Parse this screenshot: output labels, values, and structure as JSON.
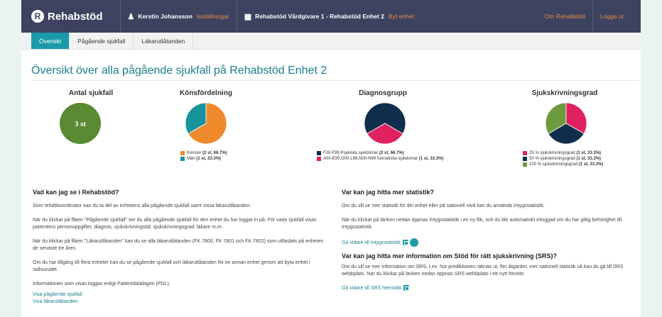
{
  "header": {
    "logo_text": "Rehabstöd",
    "logo_mark": "R",
    "user_name": "Kerstin Johansson",
    "settings_link": "Inställningar",
    "unit_name": "Rehabstöd Vårdgivare 1 - Rehabstöd Enhet 2",
    "change_unit_link": "Byt enhet",
    "about_link": "Om Rehabstöd",
    "logout_link": "Logga ut"
  },
  "tabs": [
    {
      "label": "Översikt",
      "active": true
    },
    {
      "label": "Pågående sjukfall",
      "active": false
    },
    {
      "label": "Läkarutlåtanden",
      "active": false
    }
  ],
  "page_title": "Översikt över alla pågående sjukfall på Rehabstöd Enhet 2",
  "stats": {
    "count": {
      "title": "Antal sjukfall",
      "value": "3 st",
      "color": "#5a8a34"
    },
    "gender": {
      "title": "Könsfördelning",
      "slices": [
        {
          "label": "Kvinnor",
          "detail": "(2 st, 66.7%)",
          "fraction": 0.667,
          "color": "#ef8a2c"
        },
        {
          "label": "Män",
          "detail": "(1 st, 33.3%)",
          "fraction": 0.333,
          "color": "#17939d"
        }
      ]
    },
    "diagnosis": {
      "title": "Diagnosgrupp",
      "slices": [
        {
          "label": "F00-F99 Psykiska sjukdomar",
          "detail": "(2 st, 66.7%)",
          "fraction": 0.667,
          "color": "#0f2d4d"
        },
        {
          "label": "A00-E90,G00-L99,N00-N99 Somatiska sjukdomar",
          "detail": "(1 st, 33.3%)",
          "fraction": 0.333,
          "color": "#e0215f"
        }
      ]
    },
    "degree": {
      "title": "Sjukskrivningsgrad",
      "slices": [
        {
          "label": "25 % sjukskrivningsgrad",
          "detail": "(1 st, 33.3%)",
          "fraction": 0.333,
          "color": "#e0215f"
        },
        {
          "label": "50 % sjukskrivningsgrad",
          "detail": "(1 st, 33.3%)",
          "fraction": 0.333,
          "color": "#0f2d4d"
        },
        {
          "label": "100 % sjukskrivningsgrad",
          "detail": "(1 st, 33.3%)",
          "fraction": 0.334,
          "color": "#6e9a3e"
        }
      ]
    }
  },
  "left_info": {
    "heading": "Vad kan jag se i Rehabstöd?",
    "paragraphs": [
      "Som rehabkoordinator kan du ta del av enhetens alla pågående sjukfall samt vissa läkarutlåtanden.",
      "När du klickar på fliken \"Pågående sjukfall\" ser du alla pågående sjukfall för den enhet du har loggat in på. För varje sjukfall visas patientens personuppgifter, diagnos, sjukskrivningstid, sjukskrivningsgrad, läkare m.m.",
      "När du klickar på fliken \"Läkarutlåtanden\" kan du se alla läkarutlåtanden (FK 7800, FK 7801 och FK 7802) som utfärdats på enheten de senaste tre åren.",
      "Om du har tillgång till flera enheter kan du se pågående sjukfall och läkarutlåtanden för en annan enhet genom att byta enhet i sidhuvudet.",
      "Informationen som visas loggas enligt Patientdatalagen (PDL)."
    ],
    "link_sjukfall": "Visa pågående sjukfall",
    "link_lakarutlatanden": "Visa läkarutlåtanden"
  },
  "right_info": {
    "stats_heading": "Var kan jag hitta mer statistik?",
    "stats_p1": "Om du vill se mer statistik för din enhet eller på nationell nivå kan du använda Intygsstatistik.",
    "stats_p2": "När du klickar på länken nedan öppnas Intygsstatistik i en ny flik, och du blir automatiskt inloggad om du har giltig behörighet till Intygsstatistik.",
    "stats_link": "Gå vidare till Intygsstatistik",
    "srs_heading": "Var kan jag hitta mer information om Stöd för rätt sjukskrivning (SRS)?",
    "srs_p1": "Om du vill se mer information om SRS, t.ex. hur prediktionen räknas ut, fler åtgärder, mer nationell statistik så kan du gå till SRS webbplats. När du klickar på länken nedan öppnas SRS webbplats i ett nytt fönster.",
    "srs_link": "Gå vidare till SRS hemsida"
  }
}
